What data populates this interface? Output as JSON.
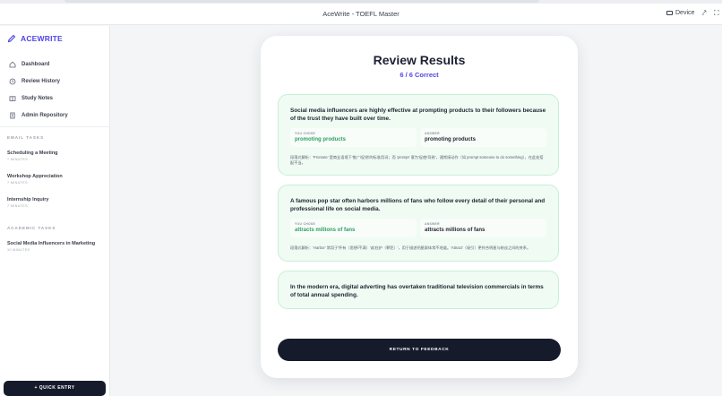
{
  "window": {
    "title": "AceWrite - TOEFL Master",
    "device_label": "Device"
  },
  "sidebar": {
    "brand": "ACEWRITE",
    "nav": [
      {
        "label": "Dashboard",
        "icon": "home-icon"
      },
      {
        "label": "Review History",
        "icon": "clock-icon"
      },
      {
        "label": "Study Notes",
        "icon": "book-icon"
      },
      {
        "label": "Admin Repository",
        "icon": "building-icon"
      }
    ],
    "email_heading": "EMAIL TASKS",
    "email_tasks": [
      {
        "title": "Scheduling a Meeting",
        "meta": "7 MINUTES"
      },
      {
        "title": "Workshop Appreciation",
        "meta": "7 MINUTES"
      },
      {
        "title": "Internship Inquiry",
        "meta": "7 MINUTES"
      }
    ],
    "academic_heading": "ACADEMIC TASKS",
    "academic_tasks": [
      {
        "title": "Social Media Influencers in Marketing",
        "meta": "10 MINUTES"
      }
    ],
    "quick_entry": "+ QUICK ENTRY"
  },
  "review": {
    "title": "Review Results",
    "score": "6 / 6 Correct",
    "you_chose_label": "YOU CHOSE",
    "answer_label": "ANSWER",
    "items": [
      {
        "question": "Social media influencers are highly effective at prompting products to their followers because of the trust they have built over time.",
        "chosen": "promoting products",
        "answer": "promoting products",
        "explanation": "段落式解析：'Promote' 是商业语境下'推广/促销'的标准用词；而 'prompt' 意为'促使/导致'，通常接动作（如 prompt someone to do something），在此处搭配不当。"
      },
      {
        "question": "A famous pop star often harbors millions of fans who follow every detail of their personal and professional life on social media.",
        "chosen": "attracts millions of fans",
        "answer": "attracts millions of fans",
        "explanation": "段落式解析：'Harbor' 常用于'怀有（思想/不满）'或'庇护（罪犯）'，用于描述明星群体常不地道。'Attract'（吸引）更符合明星与粉丝之间的关系。"
      },
      {
        "question": "In the modern era, digital adverting has overtaken traditional television commercials in terms of total annual spending.",
        "chosen": "",
        "answer": "",
        "explanation": ""
      }
    ],
    "return_button": "RETURN TO FEEDBACK"
  },
  "colors": {
    "accent": "#4f46e5",
    "correct_green": "#2f9e63",
    "card_green_bg": "#effbf3",
    "dark_button": "#161b2c"
  }
}
